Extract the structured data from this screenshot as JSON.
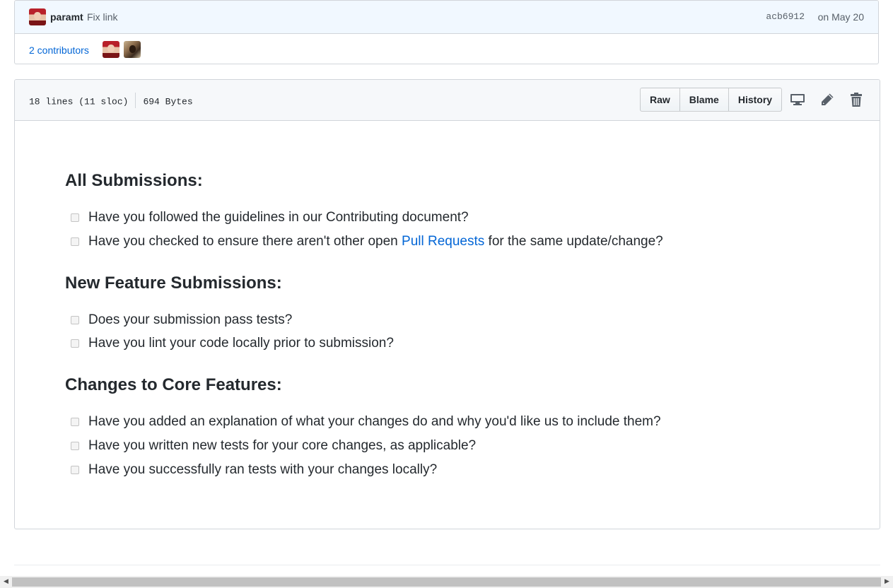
{
  "commit": {
    "author": "paramt",
    "message": "Fix link",
    "sha": "acb6912",
    "date": "on May 20",
    "contributors_label": "2 contributors"
  },
  "file": {
    "lines": "18 lines (11 sloc)",
    "size": "694 Bytes",
    "buttons": {
      "raw": "Raw",
      "blame": "Blame",
      "history": "History"
    },
    "icons": [
      "desktop-icon",
      "pencil-icon",
      "trash-icon"
    ]
  },
  "content": {
    "sections": [
      {
        "heading": "All Submissions:",
        "items": [
          {
            "text": "Have you followed the guidelines in our Contributing document?"
          },
          {
            "before": "Have you checked to ensure there aren't other open ",
            "link": "Pull Requests",
            "after": " for the same update/change?"
          }
        ]
      },
      {
        "heading": "New Feature Submissions:",
        "items": [
          {
            "text": "Does your submission pass tests?"
          },
          {
            "text": "Have you lint your code locally prior to submission?"
          }
        ]
      },
      {
        "heading": "Changes to Core Features:",
        "items": [
          {
            "text": "Have you added an explanation of what your changes do and why you'd like us to include them?"
          },
          {
            "text": "Have you written new tests for your core changes, as applicable?"
          },
          {
            "text": "Have you successfully ran tests with your changes locally?"
          }
        ]
      }
    ]
  },
  "colors": {
    "link": "#0366d6",
    "header_bg": "#f1f8ff",
    "border": "#d1d5da"
  }
}
